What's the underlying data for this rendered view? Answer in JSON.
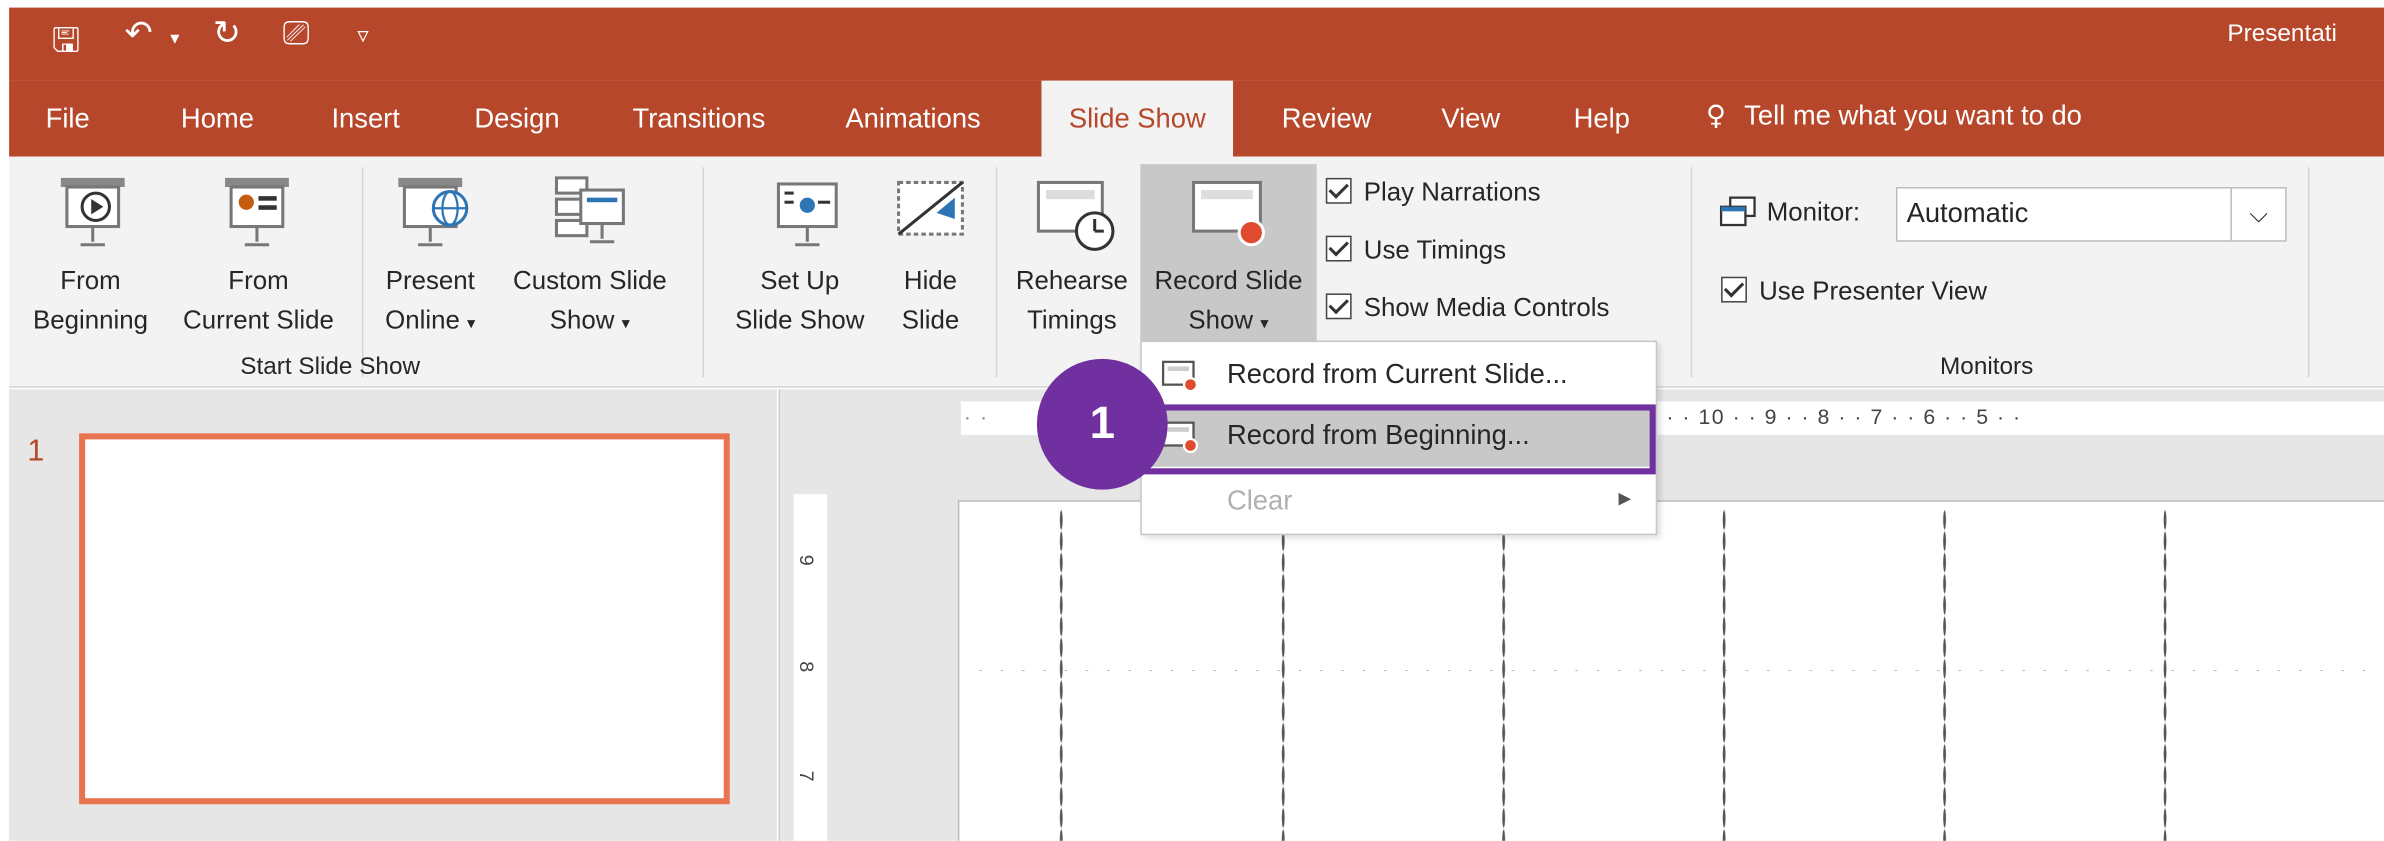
{
  "window": {
    "title": "Presentati"
  },
  "qat": {
    "save_icon": "save-icon",
    "undo_icon": "undo-icon",
    "redo_icon": "redo-icon",
    "present_icon": "present-from-start-icon",
    "customize_icon": "customize-qat-icon"
  },
  "tabs": [
    "File",
    "Home",
    "Insert",
    "Design",
    "Transitions",
    "Animations",
    "Slide Show",
    "Review",
    "View",
    "Help"
  ],
  "active_tab": "Slide Show",
  "tell_me": "Tell me what you want to do",
  "ribbon": {
    "start_group": {
      "label": "Start Slide Show",
      "from_beginning": [
        "From",
        "Beginning"
      ],
      "from_current": [
        "From",
        "Current Slide"
      ],
      "present_online": [
        "Present",
        "Online"
      ],
      "custom_show": [
        "Custom Slide",
        "Show"
      ]
    },
    "setup_group": {
      "setup": [
        "Set Up",
        "Slide Show"
      ],
      "hide": [
        "Hide",
        "Slide"
      ],
      "rehearse": [
        "Rehearse",
        "Timings"
      ],
      "record": [
        "Record Slide",
        "Show"
      ],
      "play_narrations": "Play Narrations",
      "use_timings": "Use Timings",
      "show_media_controls": "Show Media Controls"
    },
    "monitors_group": {
      "label": "Monitors",
      "monitor_label": "Monitor:",
      "monitor_value": "Automatic",
      "use_presenter_view": "Use Presenter View"
    }
  },
  "thumbnail": {
    "number": "1"
  },
  "ruler": {
    "h": "· · 10 · · 9 · · 8 · · 7 · · 6 · · 5 · ·",
    "v1": "9",
    "v2": "8",
    "v3": "7"
  },
  "menu": {
    "items": [
      {
        "label": "Record from Current Slide..."
      },
      {
        "label": "Record from Beginning..."
      },
      {
        "label": "Clear"
      }
    ]
  },
  "callout": {
    "number": "1"
  },
  "colors": {
    "accent": "#b7472a",
    "callout": "#7030a0"
  }
}
